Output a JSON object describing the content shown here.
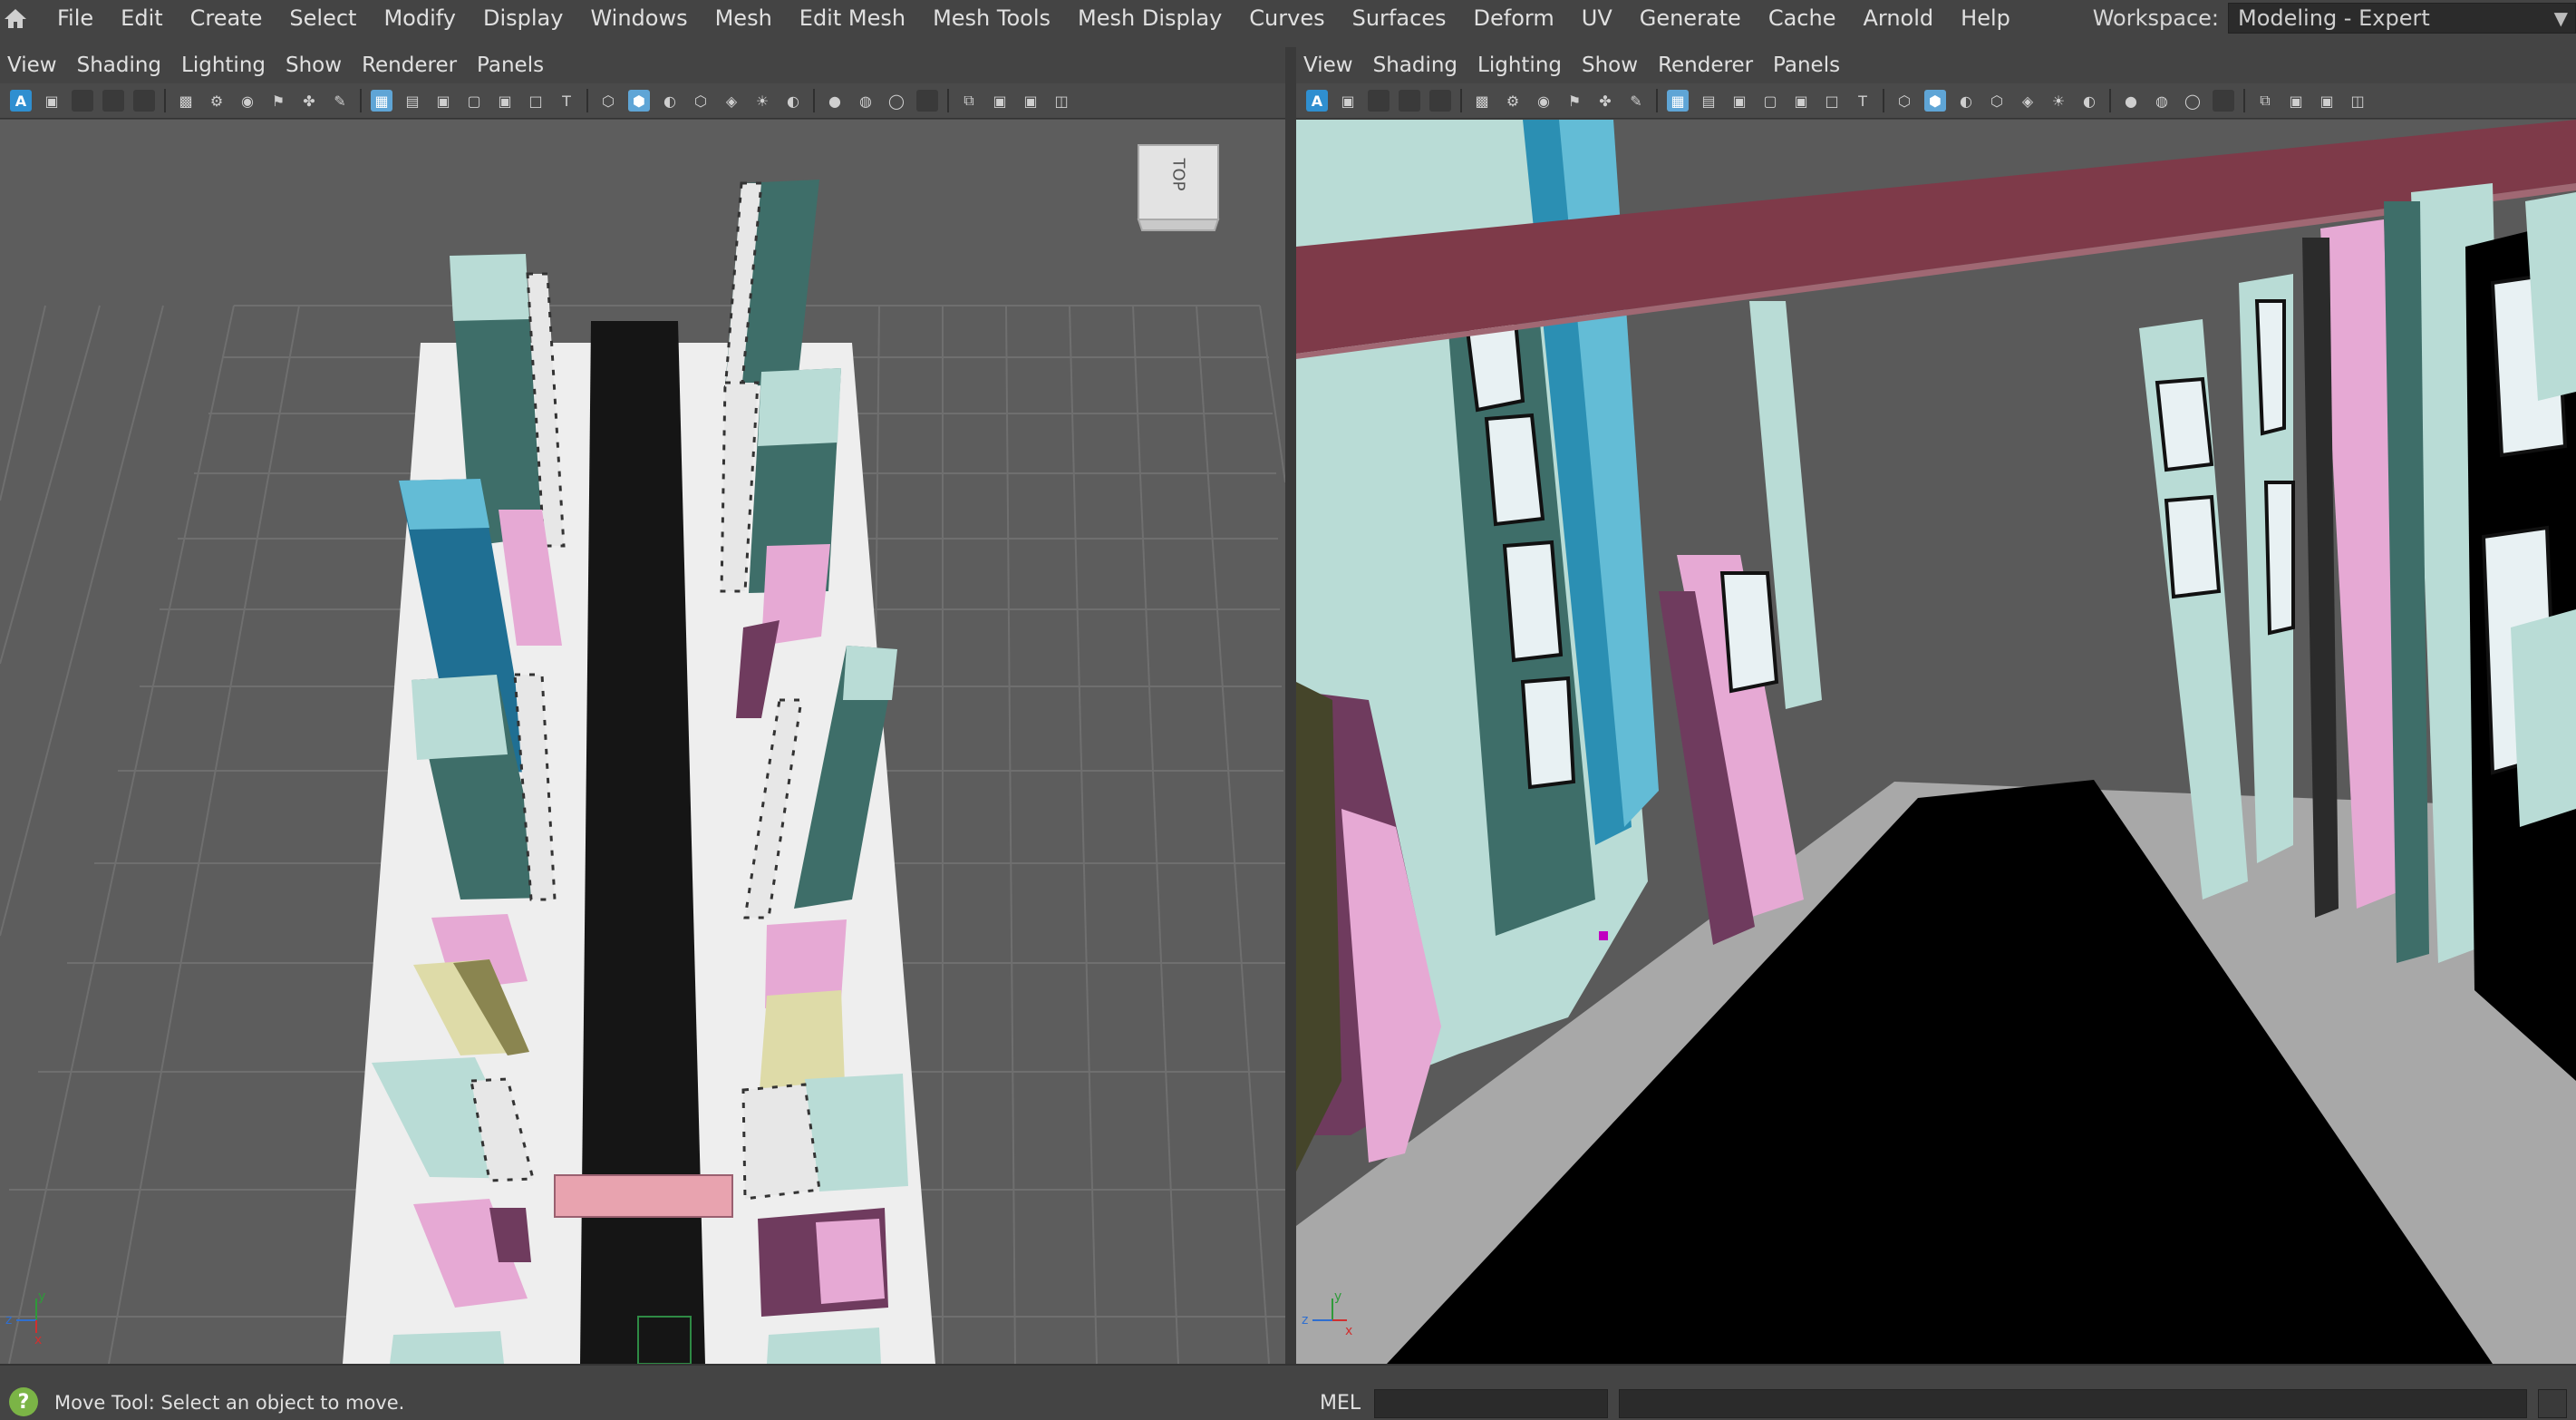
{
  "menubar": {
    "home_icon": "home-icon",
    "items": [
      "File",
      "Edit",
      "Create",
      "Select",
      "Modify",
      "Display",
      "Windows",
      "Mesh",
      "Edit Mesh",
      "Mesh Tools",
      "Mesh Display",
      "Curves",
      "Surfaces",
      "Deform",
      "UV",
      "Generate",
      "Cache",
      "Arnold",
      "Help"
    ]
  },
  "workspace": {
    "label": "Workspace:",
    "value": "Modeling - Expert"
  },
  "panel_left": {
    "menu": [
      "View",
      "Shading",
      "Lighting",
      "Show",
      "Renderer",
      "Panels"
    ],
    "view_cube_label": "TOP",
    "axis": {
      "y": "y",
      "z": "z",
      "x": "x"
    }
  },
  "panel_right": {
    "menu": [
      "View",
      "Shading",
      "Lighting",
      "Show",
      "Renderer",
      "Panels"
    ],
    "axis": {
      "y": "y",
      "z": "z",
      "x": "x"
    }
  },
  "toolbar_icons": [
    "camera-icon",
    "film-gate-icon",
    "bookmark-icon",
    "grid-icon",
    "wireframe-icon",
    "smooth-shade-icon",
    "textured-icon",
    "lighting-icon",
    "shadow-icon",
    "xray-icon",
    "isolate-icon",
    "layout-icon"
  ],
  "statusbar": {
    "help_icon": "question-icon",
    "help_text": "Move Tool: Select an object to move.",
    "mel_label": "MEL"
  },
  "colors": {
    "mint": "#b9dcd6",
    "teal_dark": "#3e6e69",
    "blue": "#2f8fb0",
    "pink": "#e6a9d4",
    "plum": "#6f3b5e",
    "olive": "#e0dcae",
    "maroon": "#7e3a49",
    "floor_white": "#eeeeee",
    "aisle_black": "#111111",
    "accent_blue": "#2f8fd0"
  }
}
